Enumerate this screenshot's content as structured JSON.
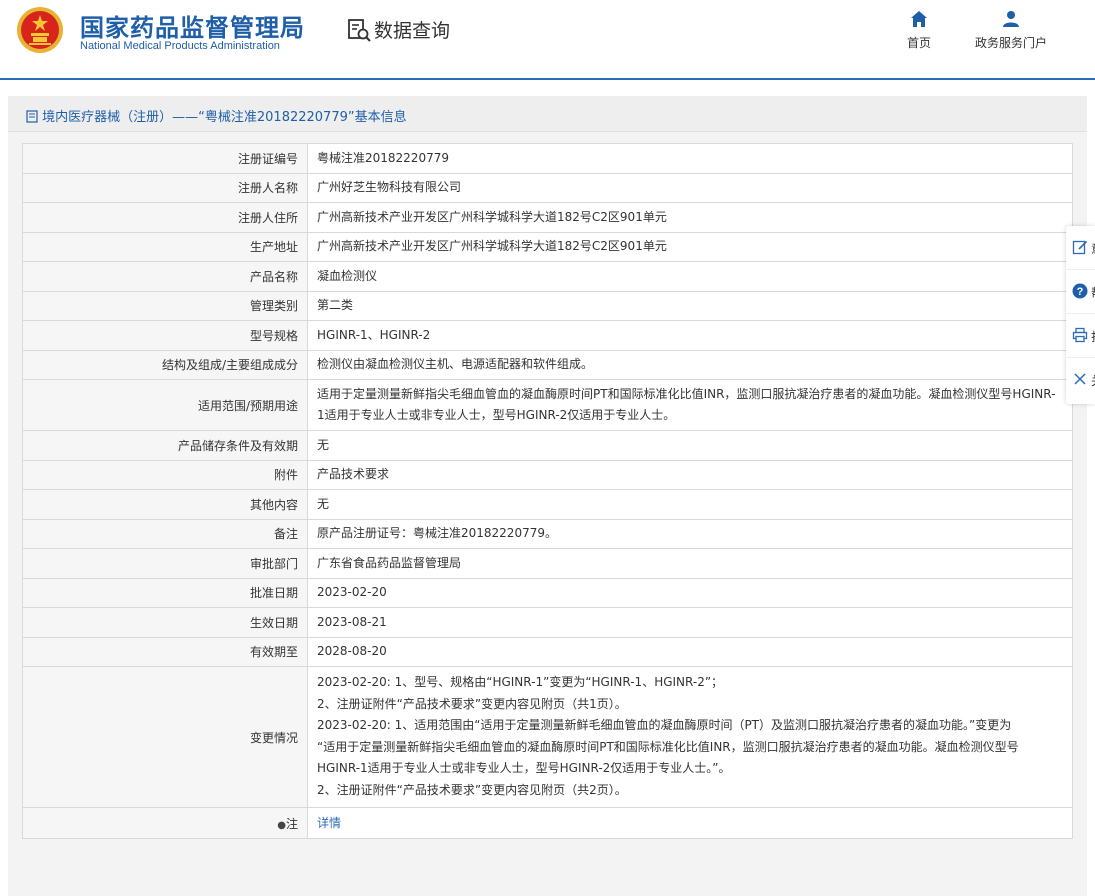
{
  "header": {
    "cn_title": "国家药品监督管理局",
    "en_title": "National Medical Products Administration",
    "query_label": "数据查询",
    "nav": [
      {
        "label": "首页",
        "icon": "home-icon"
      },
      {
        "label": "政务服务门户",
        "icon": "user-icon"
      }
    ]
  },
  "panel": {
    "title": "境内医疗器械（注册）——“粤械注准20182220779”基本信息"
  },
  "rows": [
    {
      "key": "注册证编号",
      "value": "粤械注准20182220779"
    },
    {
      "key": "注册人名称",
      "value": "广州好芝生物科技有限公司"
    },
    {
      "key": "注册人住所",
      "value": "广州高新技术产业开发区广州科学城科学大道182号C2区901单元"
    },
    {
      "key": "生产地址",
      "value": "广州高新技术产业开发区广州科学城科学大道182号C2区901单元"
    },
    {
      "key": "产品名称",
      "value": "凝血检测仪"
    },
    {
      "key": "管理类别",
      "value": "第二类"
    },
    {
      "key": "型号规格",
      "value": "HGINR-1、HGINR-2"
    },
    {
      "key": "结构及组成/主要组成成分",
      "value": "检测仪由凝血检测仪主机、电源适配器和软件组成。"
    },
    {
      "key": "适用范围/预期用途",
      "value": "适用于定量测量新鲜指尖毛细血管血的凝血酶原时间PT和国际标准化比值INR，监测口服抗凝治疗患者的凝血功能。凝血检测仪型号HGINR-1适用于专业人士或非专业人士，型号HGINR-2仅适用于专业人士。"
    },
    {
      "key": "产品储存条件及有效期",
      "value": "无"
    },
    {
      "key": "附件",
      "value": "产品技术要求"
    },
    {
      "key": "其他内容",
      "value": "无"
    },
    {
      "key": "备注",
      "value": "原产品注册证号：粤械注准20182220779。"
    },
    {
      "key": "审批部门",
      "value": "广东省食品药品监督管理局"
    },
    {
      "key": "批准日期",
      "value": "2023-02-20"
    },
    {
      "key": "生效日期",
      "value": "2023-08-21"
    },
    {
      "key": "有效期至",
      "value": "2028-08-20"
    }
  ],
  "changes": {
    "key": "变更情况",
    "lines": [
      "2023-02-20: 1、型号、规格由“HGINR-1”变更为“HGINR-1、HGINR-2”；",
      "2、注册证附件“产品技术要求”变更内容见附页（共1页）。",
      "2023-02-20: 1、适用范围由“适用于定量测量新鲜毛细血管血的凝血酶原时间（PT）及监测口服抗凝治疗患者的凝血功能。”变更为",
      "“适用于定量测量新鲜指尖毛细血管血的凝血酶原时间PT和国际标准化比值INR，监测口服抗凝治疗患者的凝血功能。凝血检测仪型号",
      "HGINR-1适用于专业人士或非专业人士，型号HGINR-2仅适用于专业人士。”。",
      "2、注册证附件“产品技术要求”变更内容见附页（共2页）。"
    ]
  },
  "note": {
    "key": "注",
    "value": "详情",
    "icon": "bulb-icon"
  },
  "side": [
    {
      "icon": "edit-icon",
      "label": "意"
    },
    {
      "icon": "help-icon",
      "label": "帮"
    },
    {
      "icon": "print-icon",
      "label": "打"
    },
    {
      "icon": "close-icon",
      "label": "关"
    }
  ],
  "colors": {
    "brand": "#1f5ea8",
    "accent": "#2b6cb6",
    "key_bg": "#f6f6f6",
    "border": "#d9d9d9"
  }
}
